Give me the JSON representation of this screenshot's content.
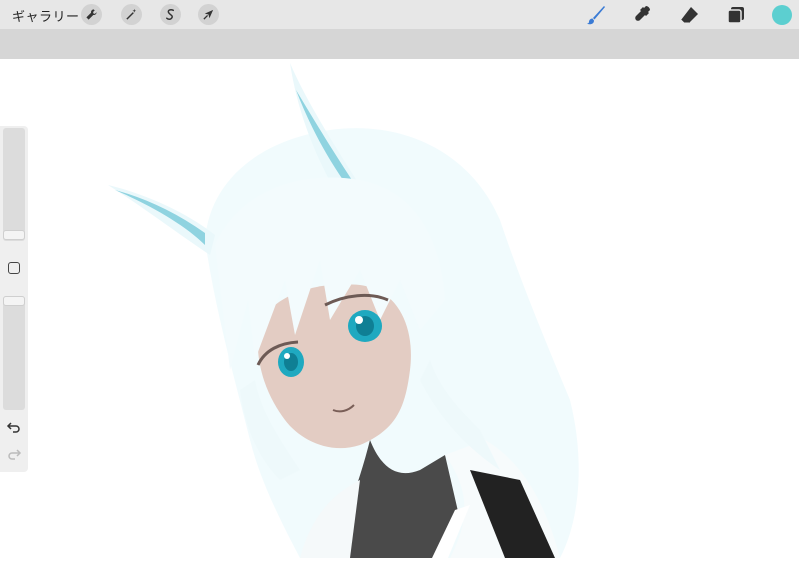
{
  "topbar": {
    "gallery_label": "ギャラリー",
    "left_tools": [
      "wrench-icon",
      "magic-wand-icon",
      "selection-icon",
      "transform-arrow-icon"
    ],
    "right_tools": [
      "brush-icon",
      "smudge-icon",
      "eraser-icon",
      "layers-icon"
    ],
    "active_tool": "brush-icon",
    "current_color": "#5ccfd0",
    "accent_color": "#3a7bd5"
  },
  "sidebar": {
    "brush_size_slider": "size-slider",
    "opacity_slider": "opacity-slider",
    "modify_button": "square-modifier-icon",
    "undo": "undo-icon",
    "redo": "redo-icon"
  },
  "canvas": {
    "artwork": "anime-girl-white-hair-cat-ears"
  }
}
